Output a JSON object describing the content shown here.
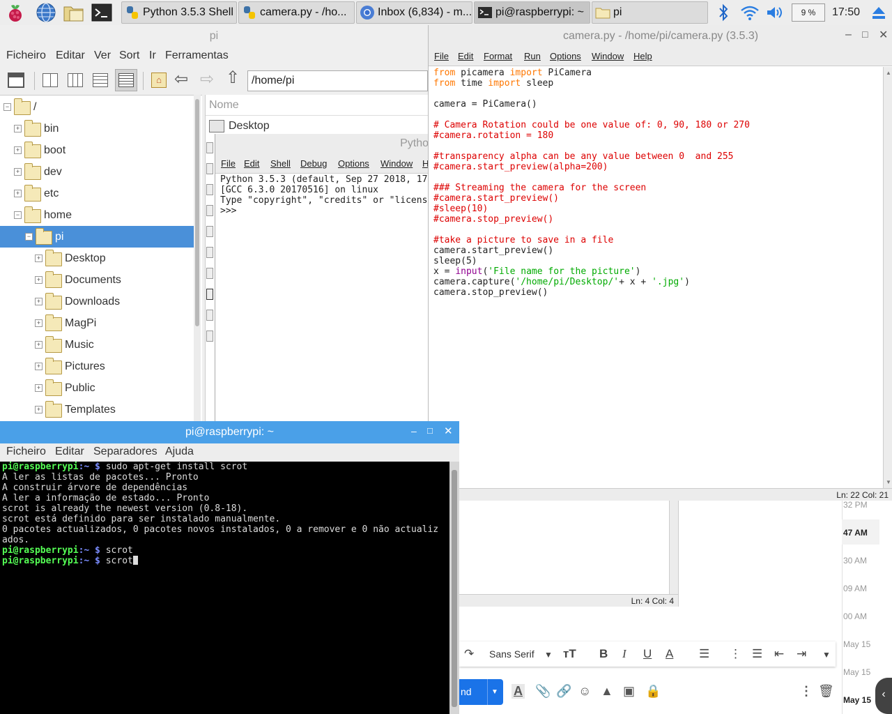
{
  "taskbar": {
    "tasks": [
      "Python 3.5.3 Shell",
      "camera.py - /ho...",
      "Inbox (6,834) - m...",
      "pi@raspberrypi: ~",
      "pi"
    ],
    "battery": "9 %",
    "clock": "17:50"
  },
  "file_manager": {
    "title": "pi",
    "menu": [
      "Ficheiro",
      "Editar",
      "Ver",
      "Sort",
      "Ir",
      "Ferramentas"
    ],
    "path": "/home/pi",
    "column_header": "Nome",
    "list_items": [
      "Desktop"
    ],
    "tree": [
      {
        "label": "/",
        "depth": 0
      },
      {
        "label": "bin",
        "depth": 1
      },
      {
        "label": "boot",
        "depth": 1
      },
      {
        "label": "dev",
        "depth": 1
      },
      {
        "label": "etc",
        "depth": 1
      },
      {
        "label": "home",
        "depth": 1
      },
      {
        "label": "pi",
        "depth": 2
      },
      {
        "label": "Desktop",
        "depth": 3
      },
      {
        "label": "Documents",
        "depth": 3
      },
      {
        "label": "Downloads",
        "depth": 3
      },
      {
        "label": "MagPi",
        "depth": 3
      },
      {
        "label": "Music",
        "depth": 3
      },
      {
        "label": "Pictures",
        "depth": 3
      },
      {
        "label": "Public",
        "depth": 3
      },
      {
        "label": "Templates",
        "depth": 3
      }
    ]
  },
  "python_shell": {
    "title_partial": "Pytho",
    "menu": [
      "File",
      "Edit",
      "Shell",
      "Debug",
      "Options",
      "Window",
      "H"
    ],
    "lines": [
      "Python 3.5.3 (default, Sep 27 2018, 17",
      "[GCC 6.3.0 20170516] on linux",
      "Type \"copyright\", \"credits\" or \"licens",
      ">>> "
    ],
    "status": "Ln: 4   Col: 4"
  },
  "editor": {
    "title": "camera.py - /home/pi/camera.py (3.5.3)",
    "menu": [
      "File",
      "Edit",
      "Format",
      "Run",
      "Options",
      "Window",
      "Help"
    ],
    "status": "Ln: 22   Col: 21",
    "code": [
      [
        [
          "kw",
          "from"
        ],
        [
          "n",
          " picamera "
        ],
        [
          "kw",
          "import"
        ],
        [
          "n",
          " PiCamera"
        ]
      ],
      [
        [
          "kw",
          "from"
        ],
        [
          "n",
          " time "
        ],
        [
          "kw",
          "import"
        ],
        [
          "n",
          " sleep"
        ]
      ],
      [],
      [
        [
          "n",
          "camera = PiCamera()"
        ]
      ],
      [],
      [
        [
          "cm",
          "# Camera Rotation could be one value of: 0, 90, 180 or 270"
        ]
      ],
      [
        [
          "cm",
          "#camera.rotation = 180"
        ]
      ],
      [],
      [
        [
          "cm",
          "#transparency alpha can be any value between 0  and 255"
        ]
      ],
      [
        [
          "cm",
          "#camera.start_preview(alpha=200)"
        ]
      ],
      [],
      [
        [
          "cm",
          "### Streaming the camera for the screen"
        ]
      ],
      [
        [
          "cm",
          "#camera.start_preview()"
        ]
      ],
      [
        [
          "cm",
          "#sleep(10)"
        ]
      ],
      [
        [
          "cm",
          "#camera.stop_preview()"
        ]
      ],
      [],
      [
        [
          "cm",
          "#take a picture to save in a file"
        ]
      ],
      [
        [
          "n",
          "camera.start_preview()"
        ]
      ],
      [
        [
          "n",
          "sleep(5)"
        ]
      ],
      [
        [
          "n",
          "x = "
        ],
        [
          "bi",
          "input"
        ],
        [
          "n",
          "("
        ],
        [
          "st",
          "'File name for the picture'"
        ],
        [
          "n",
          ")"
        ]
      ],
      [
        [
          "n",
          "camera.capture("
        ],
        [
          "st",
          "'/home/pi/Desktop/'"
        ],
        [
          "n",
          "+ x + "
        ],
        [
          "st",
          "'.jpg'"
        ],
        [
          "n",
          ")"
        ]
      ],
      [
        [
          "n",
          "camera.stop_preview()"
        ]
      ]
    ]
  },
  "terminal": {
    "title": "pi@raspberrypi: ~",
    "menu": [
      "Ficheiro",
      "Editar",
      "Separadores",
      "Ajuda"
    ],
    "lines": [
      {
        "prompt": true,
        "text": "sudo apt-get install scrot"
      },
      {
        "prompt": false,
        "text": "A ler as listas de pacotes... Pronto"
      },
      {
        "prompt": false,
        "text": "A construir árvore de dependências"
      },
      {
        "prompt": false,
        "text": "A ler a informação de estado... Pronto"
      },
      {
        "prompt": false,
        "text": "scrot is already the newest version (0.8-18)."
      },
      {
        "prompt": false,
        "text": "scrot está definido para ser instalado manualmente."
      },
      {
        "prompt": false,
        "text": "0 pacotes actualizados, 0 pacotes novos instalados, 0 a remover e 0 não actualiz"
      },
      {
        "prompt": false,
        "text": "ados."
      },
      {
        "prompt": true,
        "text": "scrot"
      },
      {
        "prompt": true,
        "text": "scrot",
        "cursor": true
      }
    ],
    "prompt_user": "pi@raspberrypi",
    "prompt_path": ":~ $ "
  },
  "gmail": {
    "times": [
      "32 PM",
      "47 AM",
      "30 AM",
      "09 AM",
      "00 AM",
      "May 15",
      "May 15",
      "May 15"
    ],
    "font": "Sans Serif",
    "send_partial": "nd"
  }
}
